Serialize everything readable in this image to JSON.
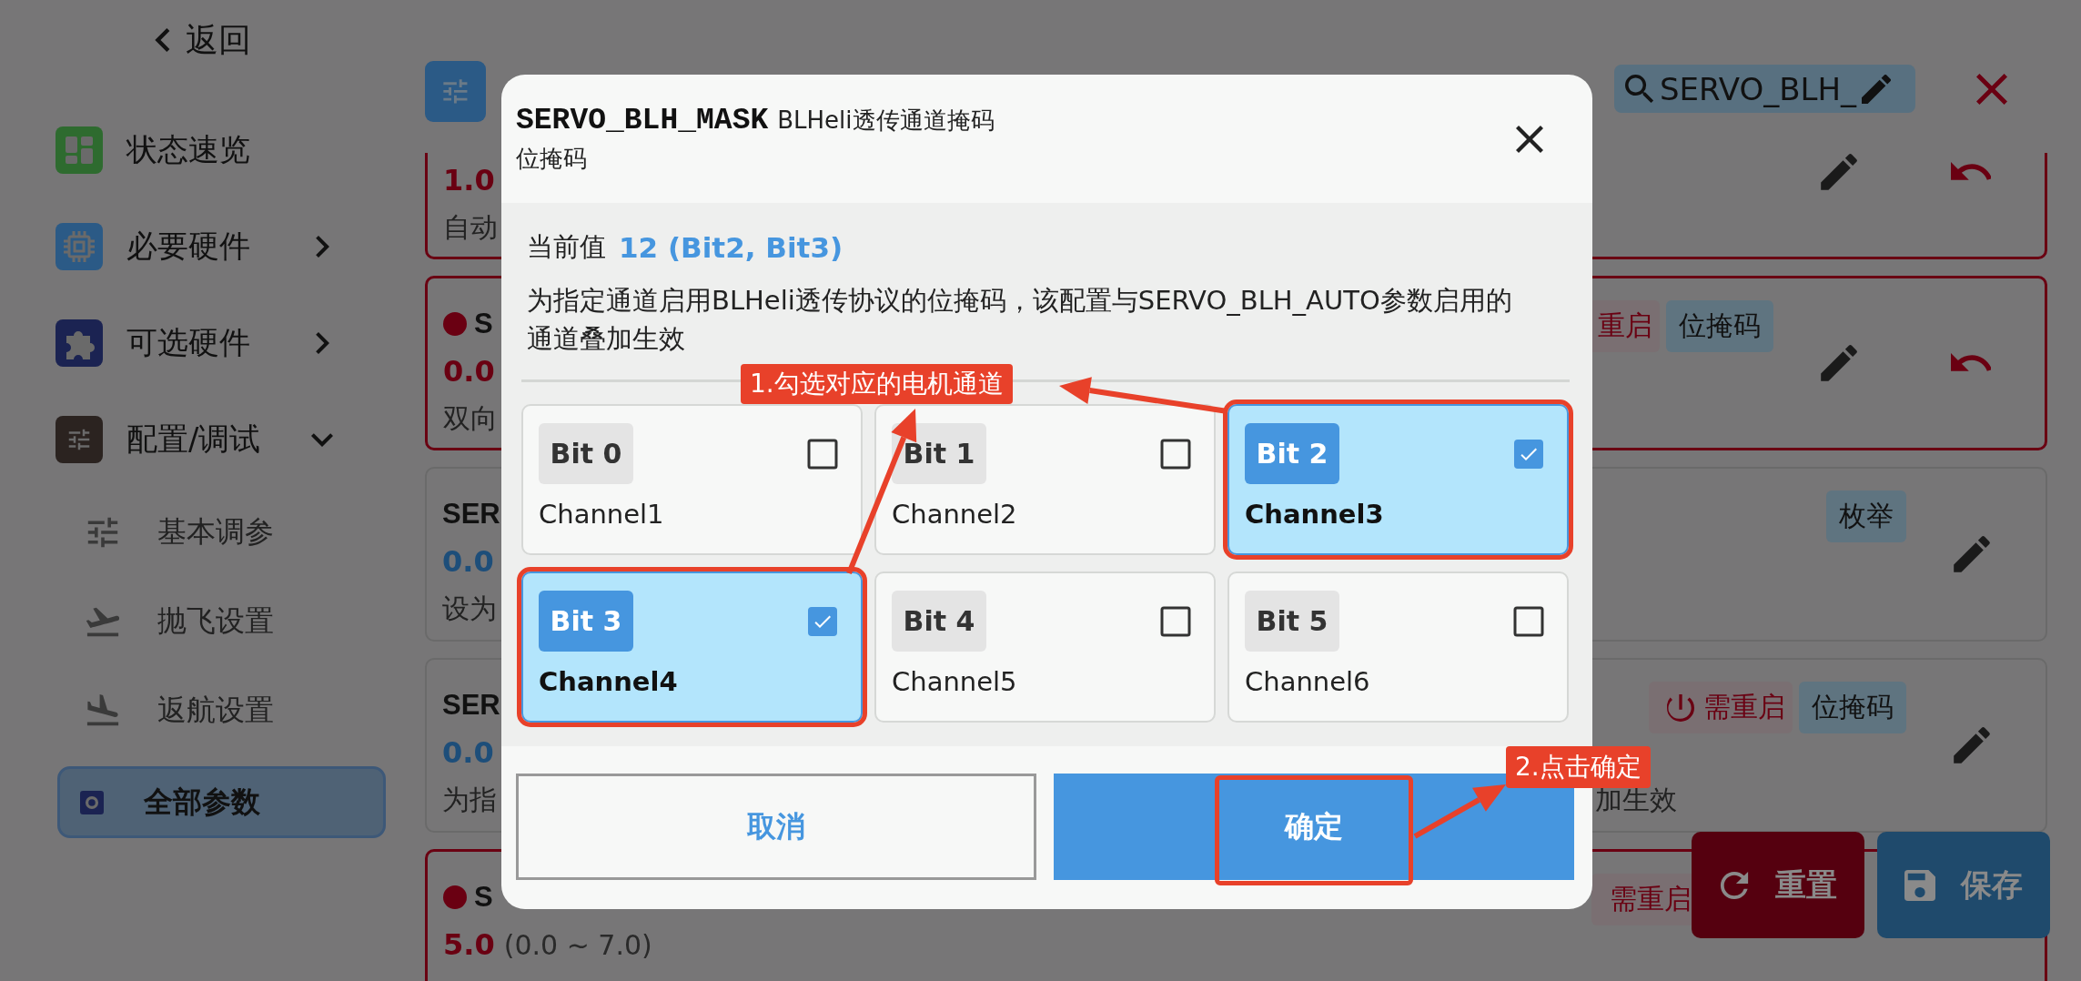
{
  "sidebar": {
    "back": {
      "label": "返回"
    },
    "items": [
      {
        "label": "状态速览",
        "selected": false
      },
      {
        "label": "必要硬件",
        "expanded": false,
        "selected": false
      },
      {
        "label": "可选硬件",
        "expanded": false,
        "selected": false
      },
      {
        "label": "配置/调试",
        "expanded": true,
        "selected": false,
        "children": [
          {
            "label": "基本调参",
            "selected": false
          },
          {
            "label": "抛飞设置",
            "selected": false
          },
          {
            "label": "返航设置",
            "selected": false
          },
          {
            "label": "全部参数",
            "selected": true
          }
        ]
      }
    ]
  },
  "header": {
    "search": {
      "value": "SERVO_BLH_"
    }
  },
  "params": [
    {
      "modified": true,
      "value": "1.0",
      "description": "自动",
      "actions": [
        {
          "kind": "edit"
        },
        {
          "kind": "revert"
        }
      ]
    },
    {
      "modified": true,
      "name": "S",
      "value": "0.0",
      "description": "双向",
      "badges": [
        {
          "kind": "reboot",
          "power_icon": false,
          "label": "重启"
        },
        {
          "kind": "type",
          "label": "位掩码"
        }
      ],
      "actions": [
        {
          "kind": "edit"
        },
        {
          "kind": "revert"
        }
      ]
    },
    {
      "modified": false,
      "name": "SER",
      "value": "0.0",
      "description": "设为",
      "badges": [
        {
          "kind": "type",
          "label": "枚举"
        }
      ],
      "actions": [
        {
          "kind": "edit"
        }
      ]
    },
    {
      "modified": false,
      "name": "SER",
      "value": "0.0",
      "description": "为指",
      "description_tail": "加生效",
      "badges": [
        {
          "kind": "reboot",
          "power_icon": true,
          "label": "需重启"
        },
        {
          "kind": "type",
          "label": "位掩码"
        }
      ],
      "actions": [
        {
          "kind": "edit"
        }
      ]
    },
    {
      "modified": true,
      "name": "S",
      "value": "5.0",
      "range": "(0.0 ~ 7.0)",
      "badges": [
        {
          "kind": "reboot",
          "power_icon": false,
          "label": "需重启"
        }
      ]
    }
  ],
  "floating_buttons": [
    {
      "kind": "reset",
      "label": "重置"
    },
    {
      "kind": "save",
      "label": "保存"
    }
  ],
  "dialog": {
    "name": "SERVO_BLH_MASK",
    "title": "BLHeli透传通道掩码",
    "type": "位掩码",
    "current_label": "当前值",
    "current_value": "12 (Bit2, Bit3)",
    "description": "为指定通道启用BLHeli透传协议的位掩码，该配置与SERVO_BLH_AUTO参数启用的通道叠加生效",
    "options": [
      {
        "bit": "Bit 0",
        "label": "Channel1",
        "checked": false,
        "highlighted": false
      },
      {
        "bit": "Bit 1",
        "label": "Channel2",
        "checked": false,
        "highlighted": false
      },
      {
        "bit": "Bit 2",
        "label": "Channel3",
        "checked": true,
        "highlighted": true
      },
      {
        "bit": "Bit 3",
        "label": "Channel4",
        "checked": true,
        "highlighted": true
      },
      {
        "bit": "Bit 4",
        "label": "Channel5",
        "checked": false,
        "highlighted": false
      },
      {
        "bit": "Bit 5",
        "label": "Channel6",
        "checked": false,
        "highlighted": false
      }
    ],
    "buttons": [
      {
        "kind": "cancel",
        "label": "取消",
        "highlighted": false
      },
      {
        "kind": "confirm",
        "label": "确定",
        "highlighted": true
      }
    ]
  },
  "annotations": [
    {
      "label": "1.勾选对应的电机通道"
    },
    {
      "label": "2.点击确定"
    }
  ]
}
